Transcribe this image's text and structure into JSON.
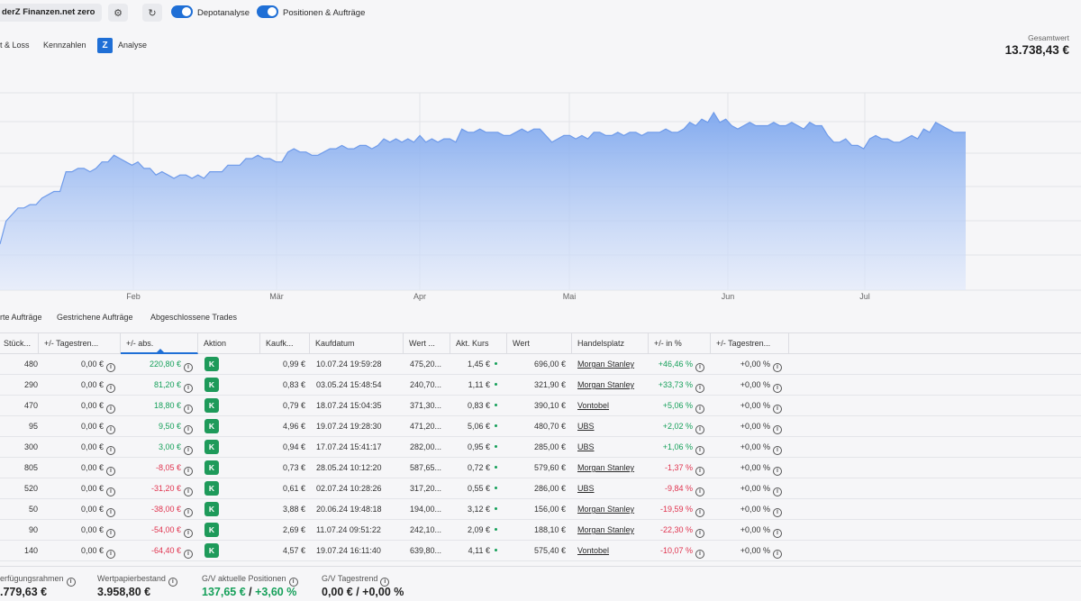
{
  "topbar": {
    "account_label": "derZ Finanzen.net zero",
    "settings_icon": "gear-icon",
    "refresh_icon": "refresh-icon",
    "toggle1_label": "Depotanalyse",
    "toggle2_label": "Positionen & Aufträge",
    "toggle1_on": true,
    "toggle2_on": true
  },
  "subnav": {
    "items": [
      "t & Loss",
      "Kennzahlen",
      "Analyse"
    ],
    "analyse_icon": "analyse-logo-icon"
  },
  "total": {
    "label": "Gesamtwert",
    "value": "13.738,43 €"
  },
  "chart_data": {
    "type": "area",
    "color": "#7ca6ee",
    "x_ticks": [
      "Feb",
      "Mär",
      "Apr",
      "Mai",
      "Jun",
      "Jul"
    ],
    "grid": true,
    "values": [
      54,
      61,
      63,
      65,
      65,
      66,
      66,
      68,
      69,
      70,
      70,
      76,
      76,
      77,
      77,
      76,
      77,
      79,
      79,
      81,
      80,
      79,
      78,
      79,
      77,
      77,
      75,
      76,
      75,
      74,
      75,
      75,
      74,
      75,
      74,
      76,
      76,
      76,
      78,
      78,
      78,
      80,
      80,
      81,
      80,
      80,
      79,
      79,
      82,
      83,
      82,
      82,
      81,
      81,
      82,
      83,
      83,
      84,
      83,
      83,
      84,
      84,
      83,
      84,
      86,
      85,
      86,
      85,
      86,
      85,
      87,
      85,
      86,
      85,
      86,
      86,
      85,
      89,
      88,
      88,
      89,
      88,
      88,
      88,
      87,
      87,
      88,
      89,
      88,
      89,
      89,
      87,
      85,
      86,
      87,
      87,
      86,
      87,
      86,
      88,
      88,
      87,
      87,
      88,
      87,
      88,
      88,
      87,
      88,
      88,
      88,
      89,
      88,
      88,
      89,
      91,
      90,
      92,
      91,
      94,
      91,
      92,
      90,
      89,
      90,
      91,
      90,
      90,
      90,
      91,
      90,
      90,
      91,
      90,
      89,
      91,
      90,
      90,
      87,
      85,
      85,
      86,
      84,
      84,
      83,
      86,
      87,
      86,
      86,
      85,
      85,
      86,
      87,
      86,
      89,
      88,
      91,
      90,
      89,
      88,
      88,
      88
    ]
  },
  "tabs": [
    "rte Aufträge",
    "Gestrichene Aufträge",
    "Abgeschlossene Trades"
  ],
  "table": {
    "headers": [
      "Stück...",
      "+/- Tagestren...",
      "+/- abs.",
      "Aktion",
      "Kaufk...",
      "Kaufdatum",
      "Wert ...",
      "Akt. Kurs",
      "Wert",
      "Handelsplatz",
      "+/- in %",
      "+/- Tagestren..."
    ],
    "action_label": "K",
    "rows": [
      {
        "qty": "480",
        "tag": "0,00 €",
        "abs": "220,80 €",
        "absSign": "pos",
        "kauf": "0,99 €",
        "datum": "10.07.24 19:59:28",
        "wert1": "475,20...",
        "kurs": "1,45 €",
        "wert": "696,00 €",
        "platz": "Morgan Stanley",
        "pct": "+46,46 %",
        "pctSign": "pos",
        "tag2": "+0,00 %"
      },
      {
        "qty": "290",
        "tag": "0,00 €",
        "abs": "81,20 €",
        "absSign": "pos",
        "kauf": "0,83 €",
        "datum": "03.05.24 15:48:54",
        "wert1": "240,70...",
        "kurs": "1,11 €",
        "wert": "321,90 €",
        "platz": "Morgan Stanley",
        "pct": "+33,73 %",
        "pctSign": "pos",
        "tag2": "+0,00 %"
      },
      {
        "qty": "470",
        "tag": "0,00 €",
        "abs": "18,80 €",
        "absSign": "pos",
        "kauf": "0,79 €",
        "datum": "18.07.24 15:04:35",
        "wert1": "371,30...",
        "kurs": "0,83 €",
        "wert": "390,10 €",
        "platz": "Vontobel",
        "pct": "+5,06 %",
        "pctSign": "pos",
        "tag2": "+0,00 %"
      },
      {
        "qty": "95",
        "tag": "0,00 €",
        "abs": "9,50 €",
        "absSign": "pos",
        "kauf": "4,96 €",
        "datum": "19.07.24 19:28:30",
        "wert1": "471,20...",
        "kurs": "5,06 €",
        "wert": "480,70 €",
        "platz": "UBS",
        "pct": "+2,02 %",
        "pctSign": "pos",
        "tag2": "+0,00 %"
      },
      {
        "qty": "300",
        "tag": "0,00 €",
        "abs": "3,00 €",
        "absSign": "pos",
        "kauf": "0,94 €",
        "datum": "17.07.24 15:41:17",
        "wert1": "282,00...",
        "kurs": "0,95 €",
        "wert": "285,00 €",
        "platz": "UBS",
        "pct": "+1,06 %",
        "pctSign": "pos",
        "tag2": "+0,00 %"
      },
      {
        "qty": "805",
        "tag": "0,00 €",
        "abs": "-8,05 €",
        "absSign": "neg",
        "kauf": "0,73 €",
        "datum": "28.05.24 10:12:20",
        "wert1": "587,65...",
        "kurs": "0,72 €",
        "wert": "579,60 €",
        "platz": "Morgan Stanley",
        "pct": "-1,37 %",
        "pctSign": "neg",
        "tag2": "+0,00 %"
      },
      {
        "qty": "520",
        "tag": "0,00 €",
        "abs": "-31,20 €",
        "absSign": "neg",
        "kauf": "0,61 €",
        "datum": "02.07.24 10:28:26",
        "wert1": "317,20...",
        "kurs": "0,55 €",
        "wert": "286,00 €",
        "platz": "UBS",
        "pct": "-9,84 %",
        "pctSign": "neg",
        "tag2": "+0,00 %"
      },
      {
        "qty": "50",
        "tag": "0,00 €",
        "abs": "-38,00 €",
        "absSign": "neg",
        "kauf": "3,88 €",
        "datum": "20.06.24 19:48:18",
        "wert1": "194,00...",
        "kurs": "3,12 €",
        "wert": "156,00 €",
        "platz": "Morgan Stanley",
        "pct": "-19,59 %",
        "pctSign": "neg",
        "tag2": "+0,00 %"
      },
      {
        "qty": "90",
        "tag": "0,00 €",
        "abs": "-54,00 €",
        "absSign": "neg",
        "kauf": "2,69 €",
        "datum": "11.07.24 09:51:22",
        "wert1": "242,10...",
        "kurs": "2,09 €",
        "wert": "188,10 €",
        "platz": "Morgan Stanley",
        "pct": "-22,30 %",
        "pctSign": "neg",
        "tag2": "+0,00 %"
      },
      {
        "qty": "140",
        "tag": "0,00 €",
        "abs": "-64,40 €",
        "absSign": "neg",
        "kauf": "4,57 €",
        "datum": "19.07.24 16:11:40",
        "wert1": "639,80...",
        "kurs": "4,11 €",
        "wert": "575,40 €",
        "platz": "Vontobel",
        "pct": "-10,07 %",
        "pctSign": "neg",
        "tag2": "+0,00 %"
      }
    ]
  },
  "footer": {
    "items": [
      {
        "label": "erfügungsrahmen",
        "value": ".779,63 €"
      },
      {
        "label": "Wertpapierbestand",
        "value": "3.958,80 €"
      },
      {
        "label": "G/V aktuelle Positionen",
        "value_abs": "137,65 €",
        "value_sep": " / ",
        "value_pct": "+3,60 %"
      },
      {
        "label": "G/V Tagestrend",
        "value": "0,00 € / +0,00 %"
      }
    ]
  },
  "colors": {
    "accent": "#1f6fd6",
    "positive": "#16a05a",
    "negative": "#e0344f",
    "action": "#1e9a5a"
  }
}
